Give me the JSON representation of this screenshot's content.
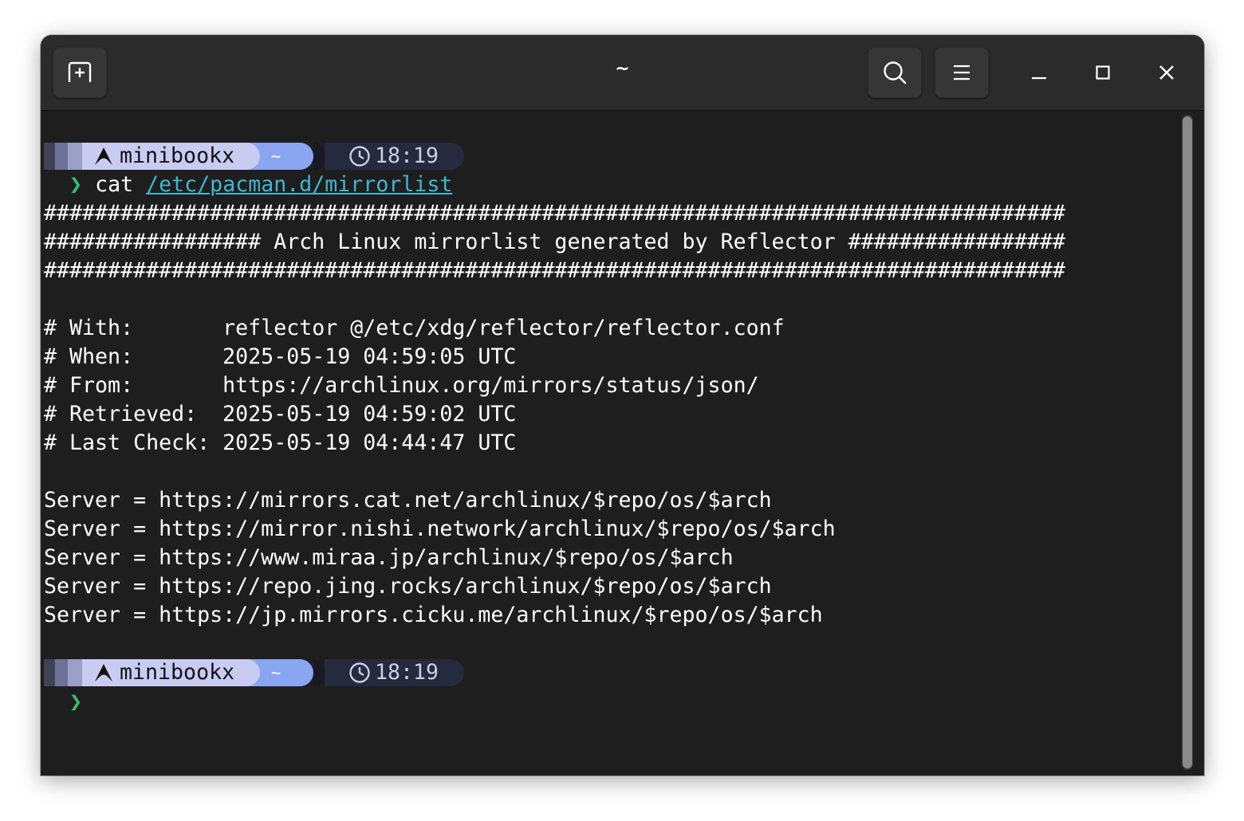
{
  "header": {
    "title": "~",
    "icons": {
      "new_tab": "new-tab-icon",
      "search": "search-icon",
      "menu": "hamburger-menu-icon",
      "minimize": "minimize-icon",
      "maximize": "maximize-icon",
      "close": "close-icon"
    }
  },
  "prompt": {
    "distro_icon": "arch-linux-icon",
    "host": "minibookx",
    "dir": "~",
    "clock_icon": "clock-icon",
    "time": "18:19",
    "symbol": "❯"
  },
  "command": {
    "name": "cat",
    "path": "/etc/pacman.d/mirrorlist"
  },
  "output": {
    "banner": [
      "################################################################################",
      "################# Arch Linux mirrorlist generated by Reflector #################",
      "################################################################################"
    ],
    "meta": [
      "# With:       reflector @/etc/xdg/reflector/reflector.conf",
      "# When:       2025-05-19 04:59:05 UTC",
      "# From:       https://archlinux.org/mirrors/status/json/",
      "# Retrieved:  2025-05-19 04:59:02 UTC",
      "# Last Check: 2025-05-19 04:44:47 UTC"
    ],
    "servers": [
      "Server = https://mirrors.cat.net/archlinux/$repo/os/$arch",
      "Server = https://mirror.nishi.network/archlinux/$repo/os/$arch",
      "Server = https://www.miraa.jp/archlinux/$repo/os/$arch",
      "Server = https://repo.jing.rocks/archlinux/$repo/os/$arch",
      "Server = https://jp.mirrors.cicku.me/archlinux/$repo/os/$arch"
    ]
  },
  "colors": {
    "terminal_bg": "#1e1e1e",
    "header_bg": "#2b2b2b",
    "text": "#ffffff",
    "prompt_green": "#2ec27e",
    "path_link": "#3fb8d0",
    "host_seg": "#c8ccf3",
    "dir_seg": "#8aa6f2",
    "time_seg": "#262a3e"
  }
}
